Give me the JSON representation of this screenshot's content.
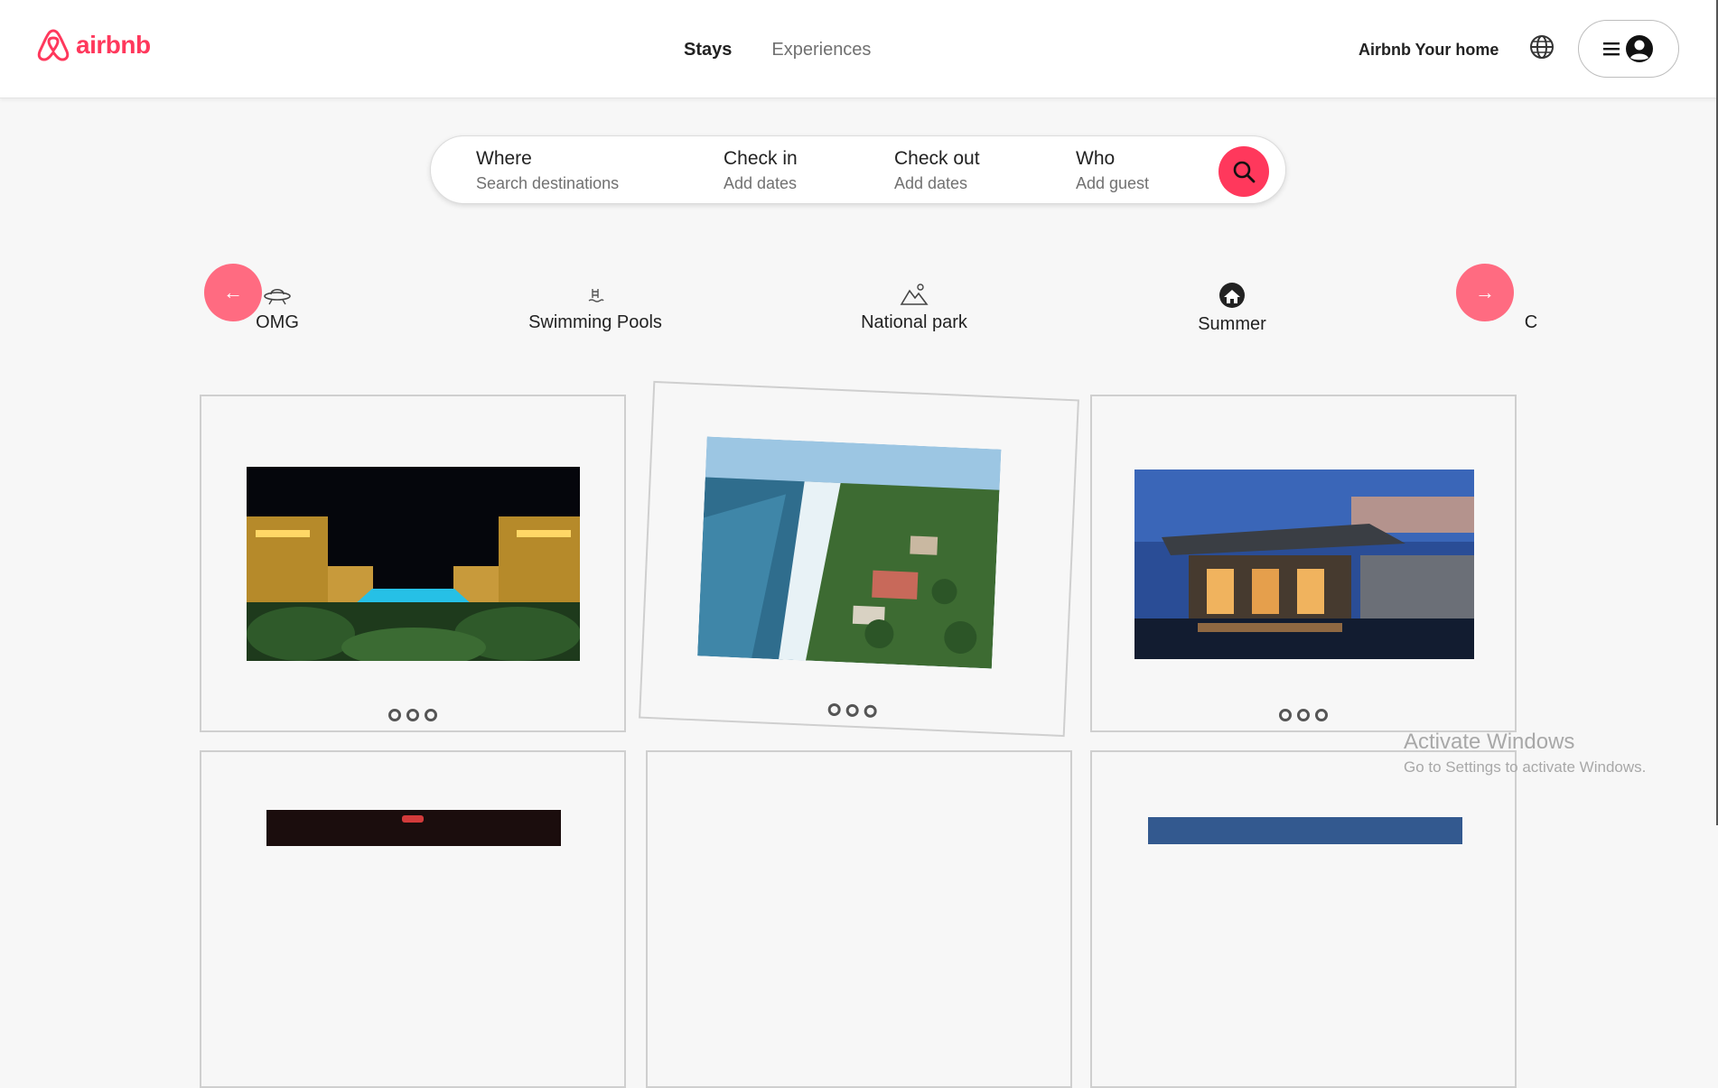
{
  "brand": {
    "name": "airbnb",
    "accent": "#ff385c"
  },
  "nav": {
    "tabs": [
      {
        "label": "Stays"
      },
      {
        "label": "Experiences"
      }
    ]
  },
  "header": {
    "host_link": "Airbnb Your home",
    "globe_icon": "globe-icon",
    "menu_icon": "hamburger-icon",
    "avatar_icon": "user-avatar-icon"
  },
  "search": {
    "fields": [
      {
        "label": "Where",
        "placeholder": "Search destinations"
      },
      {
        "label": "Check in",
        "placeholder": "Add dates"
      },
      {
        "label": "Check out",
        "placeholder": "Add dates"
      },
      {
        "label": "Who",
        "placeholder": "Add guest"
      }
    ],
    "button_icon": "search-icon"
  },
  "categories": {
    "prev_label": "←",
    "next_label": "→",
    "items": [
      {
        "label": "OMG",
        "icon": "ufo-icon"
      },
      {
        "label": "Swimming Pools",
        "icon": "pool-icon"
      },
      {
        "label": "National park",
        "icon": "mountain-icon"
      },
      {
        "label": "Summer",
        "icon": "beach-house-icon"
      },
      {
        "label": "C",
        "icon": ""
      }
    ]
  },
  "listings": [
    {
      "photo": "palace-pool-night",
      "dots": 3
    },
    {
      "photo": "coastal-resort-aerial",
      "dots": 3
    },
    {
      "photo": "modern-villa-dusk",
      "dots": 3
    }
  ],
  "watermark": {
    "title": "Activate Windows",
    "subtitle": "Go to Settings to activate Windows."
  }
}
